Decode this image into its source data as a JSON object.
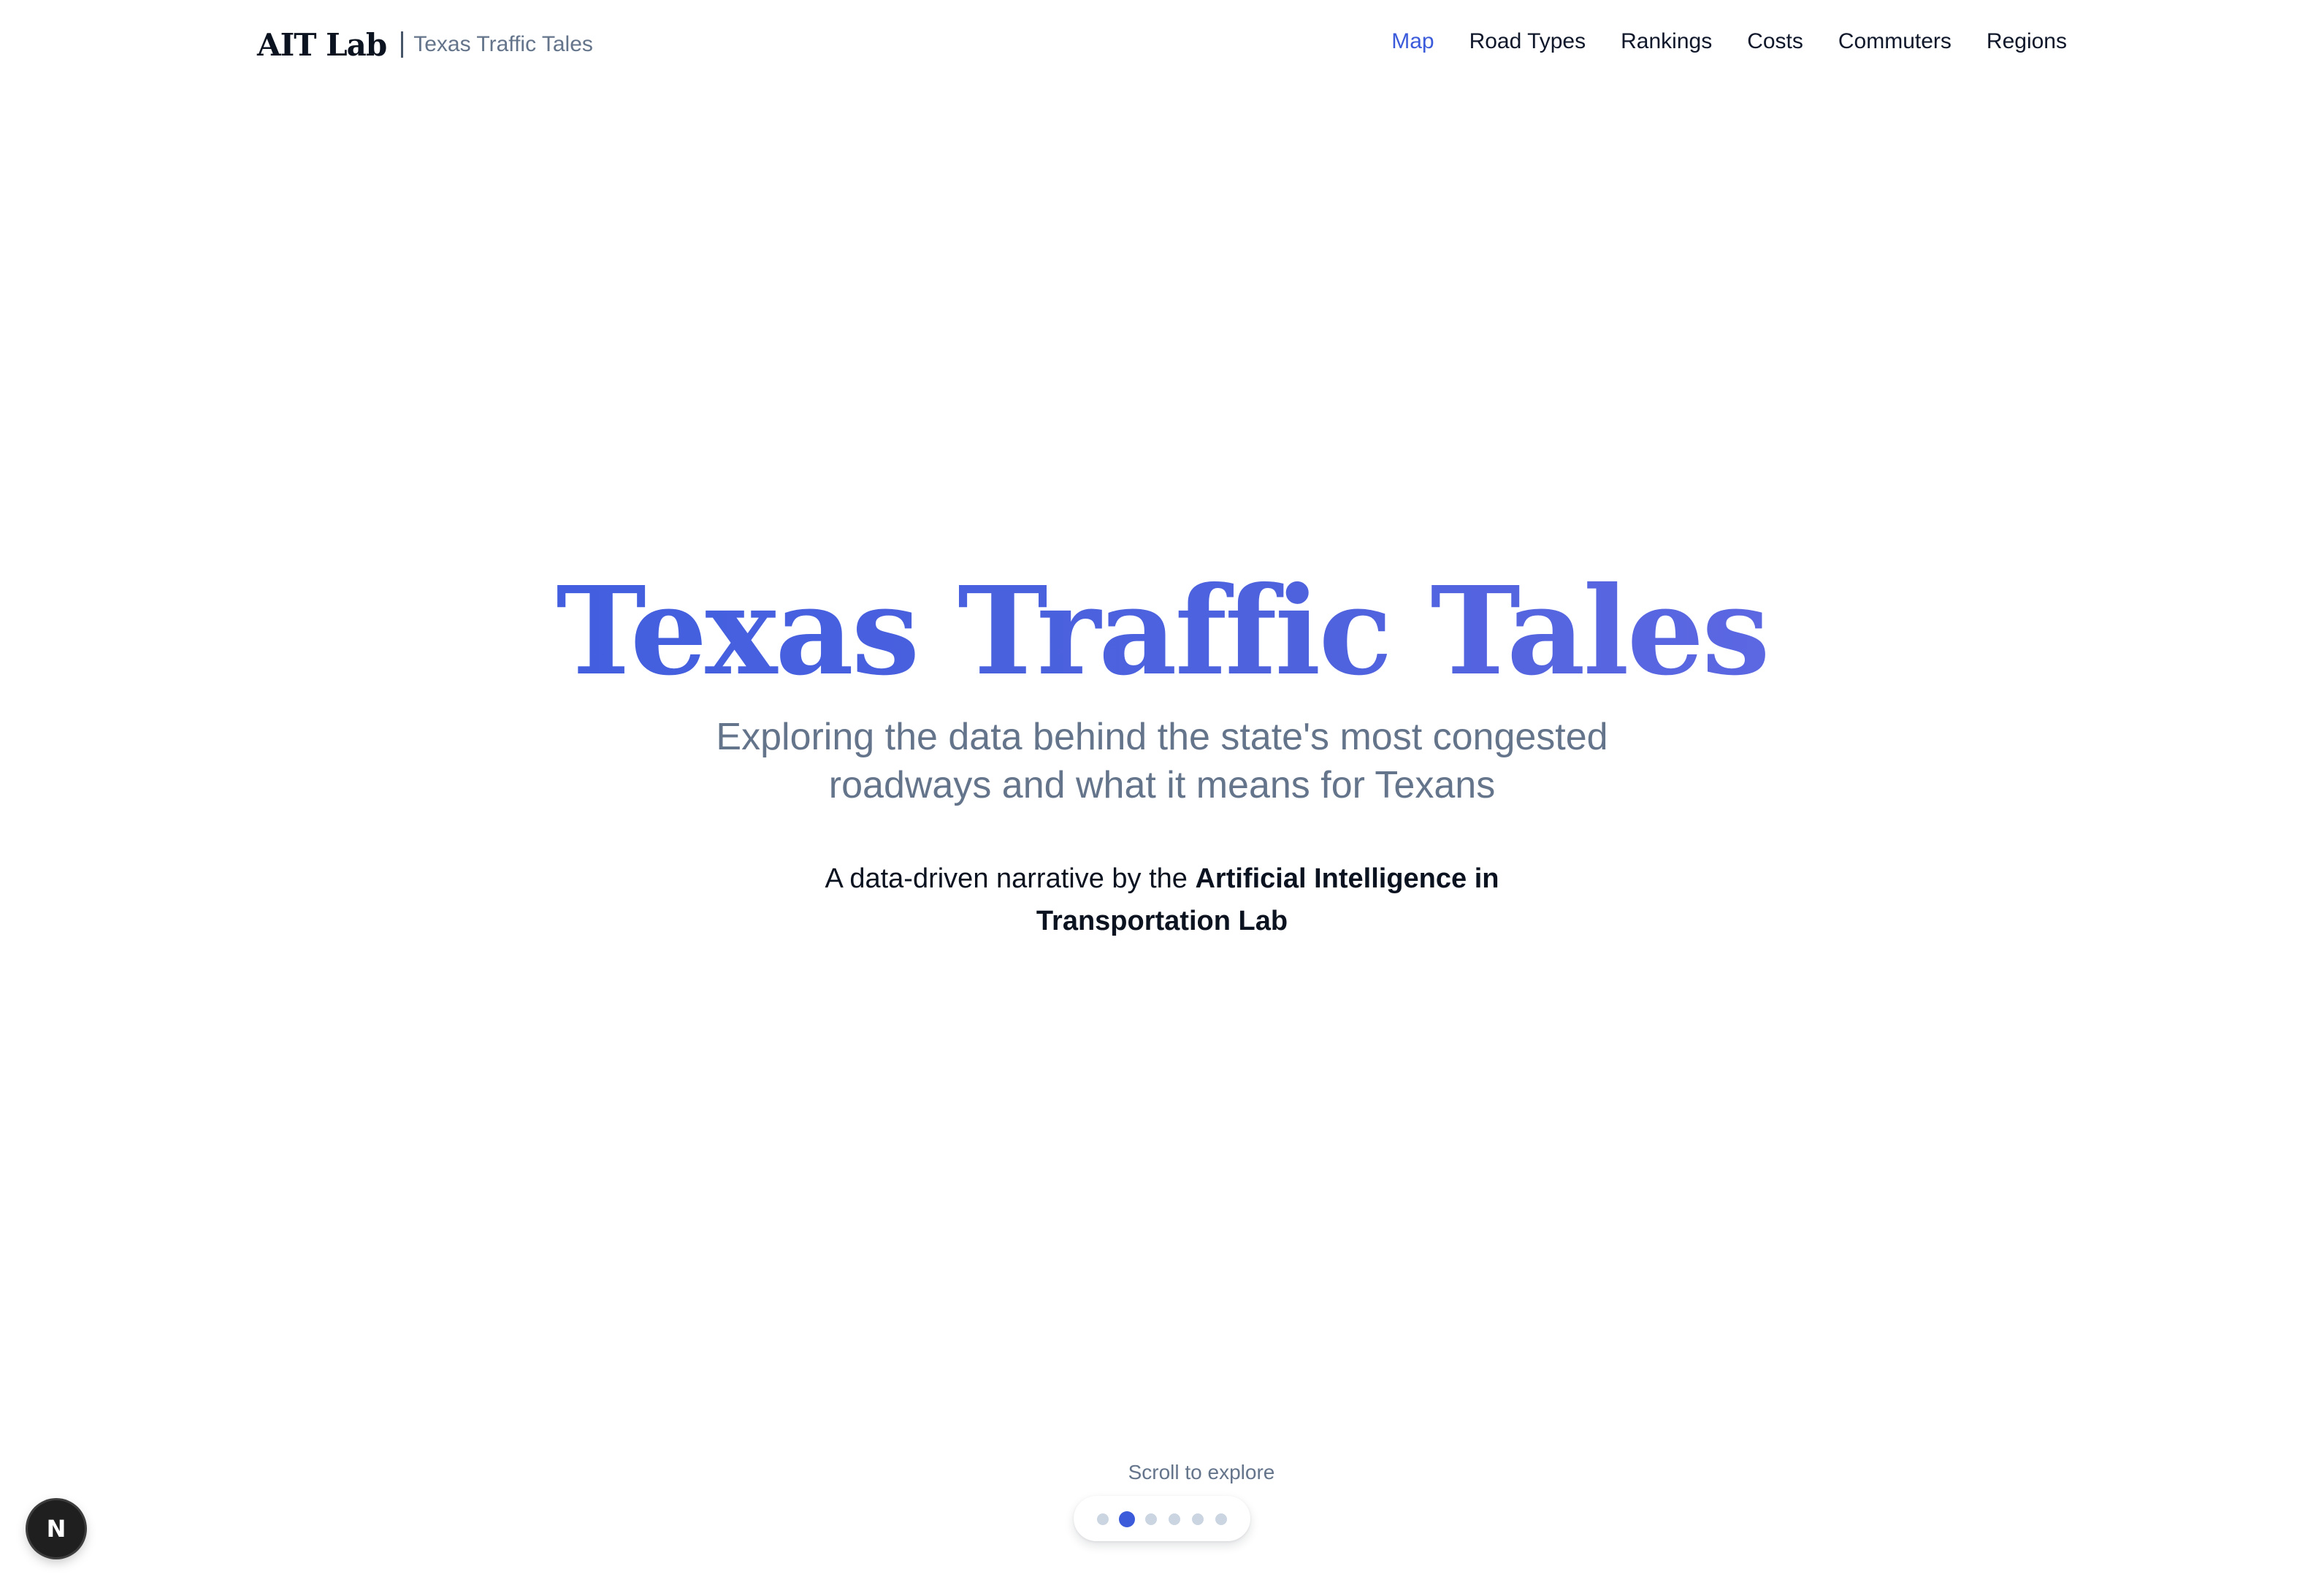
{
  "header": {
    "logo": "AIT Lab",
    "subtitle": "Texas Traffic Tales",
    "nav": [
      {
        "label": "Map",
        "active": true
      },
      {
        "label": "Road Types",
        "active": false
      },
      {
        "label": "Rankings",
        "active": false
      },
      {
        "label": "Costs",
        "active": false
      },
      {
        "label": "Commuters",
        "active": false
      },
      {
        "label": "Regions",
        "active": false
      }
    ]
  },
  "hero": {
    "title": "Texas Traffic Tales",
    "subtitle": "Exploring the data behind the state's most congested roadways and what it means for Texans",
    "credit_prefix": "A data-driven narrative by the ",
    "credit_org": "Artificial Intelligence in Transportation Lab"
  },
  "scroll": {
    "label": "Scroll to explore",
    "section_count": 6,
    "active_index": 1
  },
  "badge": {
    "letter": "N",
    "icon": "n-logo-icon"
  },
  "colors": {
    "accent": "#3b5bdb",
    "title_gradient_start": "#3a5de0",
    "title_gradient_end": "#6b6ee6",
    "muted_text": "#64748b",
    "dot_inactive": "#cbd5e1",
    "badge_bg": "#1f1f1f"
  }
}
